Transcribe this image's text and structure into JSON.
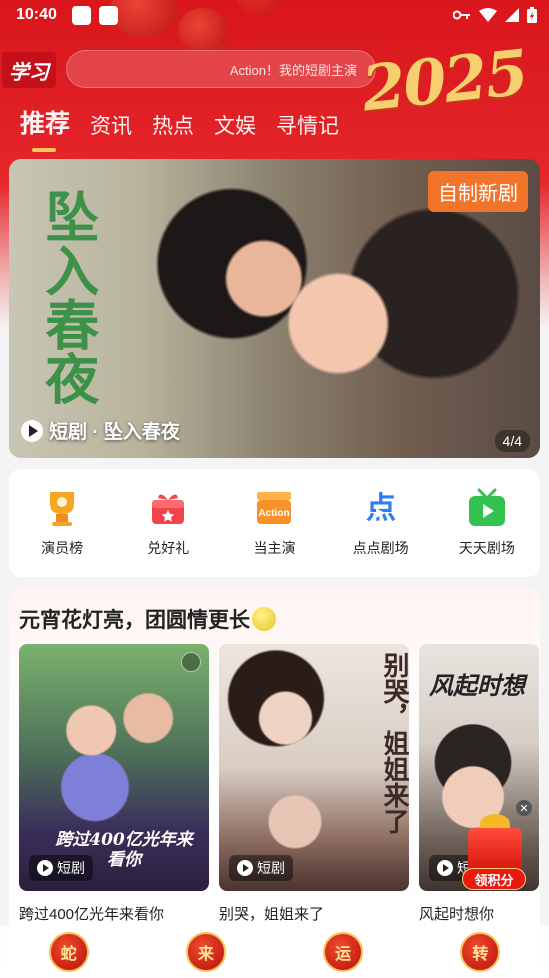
{
  "status_bar": {
    "time": "10:40"
  },
  "header": {
    "logo_text": "学习",
    "search_placeholder": "Action！我的短剧主演",
    "year_text": "2025"
  },
  "tabs": [
    "推荐",
    "资讯",
    "热点",
    "文娱",
    "寻情记"
  ],
  "banner": {
    "calligraphy": "坠入春夜",
    "badge": "自制新剧",
    "caption": "短剧 · 坠入春夜",
    "counter": "4/4"
  },
  "quick_links": [
    {
      "label": "演员榜",
      "icon": "trophy-icon",
      "color": "#f5a623"
    },
    {
      "label": "兑好礼",
      "icon": "gift-icon",
      "color": "#f2454b"
    },
    {
      "label": "当主演",
      "icon": "clapperboard-icon",
      "color": "#f7912a",
      "icon_text": "Action"
    },
    {
      "label": "点点剧场",
      "icon": "dian-theater-icon",
      "color": "#2d7cf2",
      "icon_text": "点"
    },
    {
      "label": "天天剧场",
      "icon": "tv-icon",
      "color": "#33c24d"
    }
  ],
  "section": {
    "title": "元宵花灯亮，团圆情更长",
    "cards": [
      {
        "title": "跨过400亿光年来看你",
        "poster_text": "跨过400亿光年来看你",
        "tag": "短剧"
      },
      {
        "title": "别哭，姐姐来了",
        "poster_text": "别哭，姐姐来了",
        "tag": "短剧"
      },
      {
        "title": "风起时想你",
        "poster_text": "风起时想",
        "tag": "短"
      }
    ]
  },
  "float_widget": {
    "label": "领积分",
    "close": "✕"
  },
  "bottom_bar": [
    "蛇",
    "来",
    "运",
    "转"
  ],
  "colors": {
    "brand_red": "#d8161b",
    "accent_gold": "#ffce5c"
  }
}
